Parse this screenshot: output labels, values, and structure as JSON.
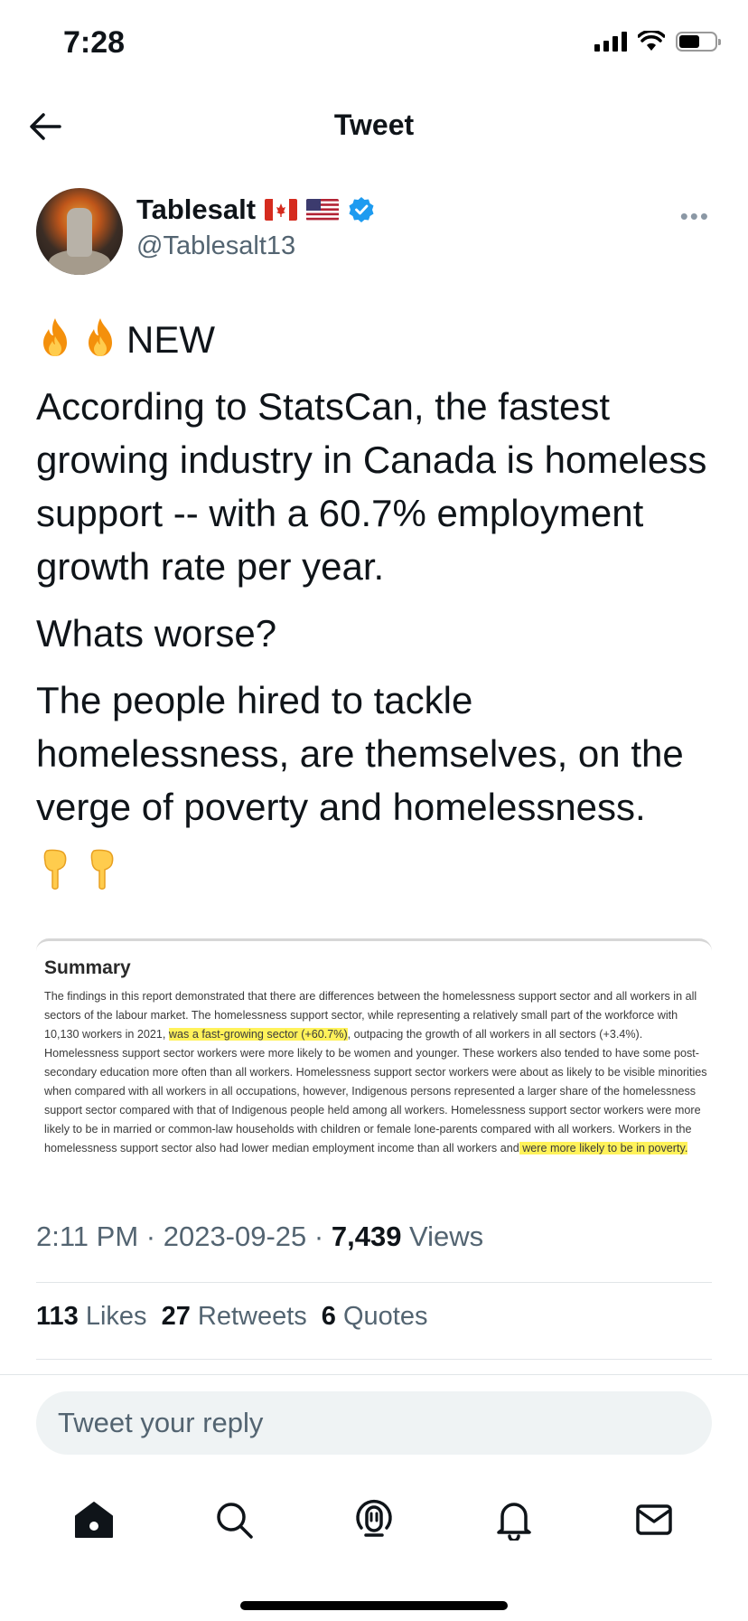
{
  "status_bar": {
    "time": "7:28"
  },
  "nav": {
    "title": "Tweet"
  },
  "author": {
    "display_name": "Tablesalt",
    "handle": "@Tablesalt13"
  },
  "tweet": {
    "headline": "NEW",
    "paragraphs": [
      "According to StatsCan, the fastest growing industry in Canada is homeless support -- with a 60.7% employment growth rate per year.",
      "Whats worse?",
      "The people hired to tackle homelessness, are themselves, on the verge of poverty and homelessness."
    ]
  },
  "media": {
    "title": "Summary",
    "text_part1": "The findings in this report demonstrated that there are differences between the homelessness support sector and all workers in all sectors of the labour market. The homelessness support sector, while representing a relatively small part of the workforce with 10,130 workers in 2021, ",
    "highlight1": "was a fast-growing sector (+60.7%)",
    "text_part2": ", outpacing the growth of all workers in all sectors (+3.4%). Homelessness support sector workers were more likely to be women and younger. These workers also tended to have some post-secondary education more often than all workers. Homelessness support sector workers were about as likely to be visible minorities when compared with all workers in all occupations, however, Indigenous persons represented a larger share of the homelessness support sector compared with that of Indigenous people held among all workers. Homelessness support sector workers were more likely to be in married or common-law households with children or female lone-parents compared with all workers. Workers in the homelessness support sector also had lower median employment income than all workers and",
    "highlight2": " were more likely to be in poverty. "
  },
  "meta": {
    "time": "2:11 PM",
    "sep1": " · ",
    "date": "2023-09-25",
    "sep2": " · ",
    "views_count": "7,439",
    "views_label": " Views"
  },
  "stats": {
    "likes_count": "113",
    "likes_label": "Likes",
    "retweets_count": "27",
    "retweets_label": "Retweets",
    "quotes_count": "6",
    "quotes_label": "Quotes"
  },
  "reply": {
    "placeholder": "Tweet your reply"
  },
  "colors": {
    "accent": "#1d9bf0",
    "secondary_text": "#536471",
    "highlight": "#fff25a"
  },
  "tabbar": {
    "icons": [
      "home-icon",
      "search-icon",
      "spaces-icon",
      "notifications-icon",
      "messages-icon"
    ]
  }
}
